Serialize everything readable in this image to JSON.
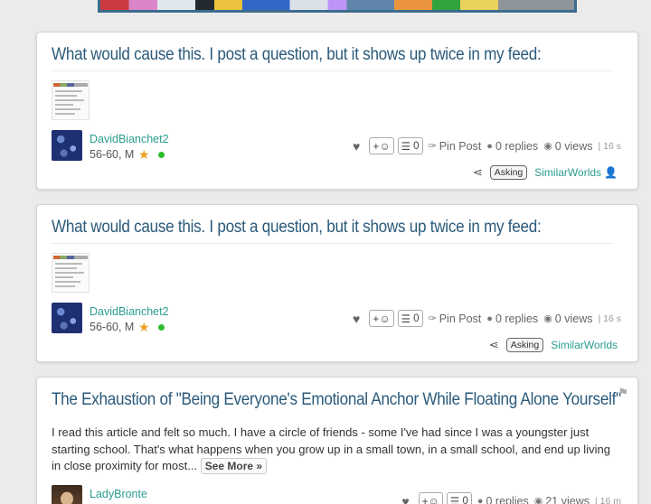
{
  "posts": [
    {
      "title": "What would cause this. I post a question, but it shows up twice in my feed:",
      "username": "DavidBianchet2",
      "meta": "56-60, M",
      "reactions": "+☺",
      "tasks_count": "0",
      "pin_label": "Pin Post",
      "replies": "0 replies",
      "views": "0 views",
      "age": "16 s",
      "tag": "Asking",
      "group": "SimilarWorlds"
    },
    {
      "title": "What would cause this. I post a question, but it shows up twice in my feed:",
      "username": "DavidBianchet2",
      "meta": "56-60, M",
      "reactions": "+☺",
      "tasks_count": "0",
      "pin_label": "Pin Post",
      "replies": "0 replies",
      "views": "0 views",
      "age": "16 s",
      "tag": "Asking",
      "group": "SimilarWorlds"
    },
    {
      "title": "The Exhaustion of \"Being Everyone's Emotional Anchor While Floating Alone Yourself\"",
      "body": "I read this article and felt so much. I have a circle of friends - some I've had since I was a youngster just starting school. That's what happens when you grow up in a small town, in a small school, and end up living in close proximity for most...",
      "see_more": "See More »",
      "username": "LadyBronte",
      "reactions": "+☺",
      "tasks_count": "0",
      "replies": "0 replies",
      "views": "21 views",
      "age": "16 m"
    }
  ],
  "icons": {
    "heart": "heart-icon",
    "pin": "pin-icon",
    "reply": "speech-bubble-icon",
    "views": "eye-icon",
    "share": "share-icon",
    "flag": "flag-icon"
  },
  "colors": {
    "title": "#2b5a7a",
    "link": "#2a9d8f",
    "online": "#2ebd2e",
    "star": "#f0a020"
  }
}
